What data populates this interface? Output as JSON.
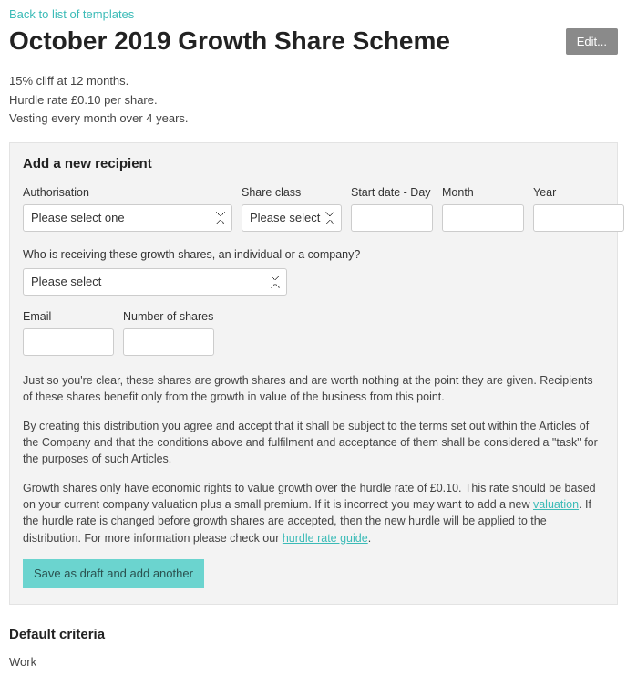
{
  "back_link": "Back to list of templates",
  "title": "October 2019 Growth Share Scheme",
  "edit_label": "Edit...",
  "summary": {
    "line1": "15% cliff at 12 months.",
    "line2": "Hurdle rate £0.10 per share.",
    "line3": "Vesting every month over 4 years."
  },
  "form": {
    "heading": "Add a new recipient",
    "authorisation_label": "Authorisation",
    "authorisation_placeholder": "Please select one",
    "share_class_label": "Share class",
    "share_class_placeholder": "Please select one",
    "start_day_label": "Start date - Day",
    "start_month_label": "Month",
    "start_year_label": "Year",
    "recipient_question": "Who is receiving these growth shares, an individual or a company?",
    "recipient_placeholder": "Please select",
    "email_label": "Email",
    "num_shares_label": "Number of shares",
    "explain1": "Just so you're clear, these shares are growth shares and are worth nothing at the point they are given. Recipients of these shares benefit only from the growth in value of the business from this point.",
    "explain2": "By creating this distribution you agree and accept that it shall be subject to the terms set out within the Articles of the Company and that the conditions above and fulfilment and acceptance of them shall be considered a \"task\" for the purposes of such Articles.",
    "explain3_a": "Growth shares only have economic rights to value growth over the hurdle rate of £0.10. This rate should be based on your current company valuation plus a small premium. If it is incorrect you may want to add a new ",
    "valuation_link": "valuation",
    "explain3_b": ". If the hurdle rate is changed before growth shares are accepted, then the new hurdle will be applied to the distribution. For more information please check our ",
    "hurdle_link": "hurdle rate guide",
    "explain3_c": ".",
    "draft_button": "Save as draft and add another"
  },
  "criteria": {
    "heading": "Default criteria",
    "item1": "Work"
  }
}
